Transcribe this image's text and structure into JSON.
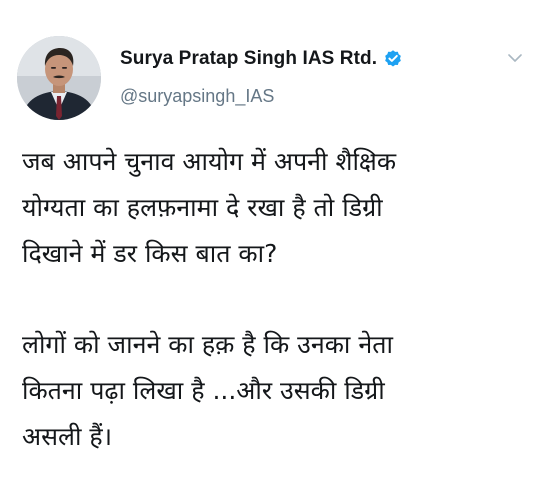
{
  "author": {
    "display_name": "Surya Pratap Singh IAS Rtd.",
    "handle": "@suryapsingh_IAS",
    "verified": true,
    "avatar_icon": "profile-photo",
    "verified_icon": "verified-badge-icon",
    "verified_color": "#1da1f2"
  },
  "menu": {
    "icon": "chevron-down-icon"
  },
  "tweet": {
    "paragraphs": [
      {
        "lines": [
          "जब आपने चुनाव आयोग में अपनी शैक्षिक",
          "योग्यता का हलफ़नामा दे रखा है तो डिग्री",
          "दिखाने में डर किस बात का?"
        ]
      },
      {
        "lines": [
          "लोगों को जानने का हक़ है कि उनका नेता",
          "कितना पढ़ा लिखा है ...और उसकी डिग्री",
          "असली हैं।"
        ]
      }
    ]
  },
  "colors": {
    "name_text": "#14171a",
    "handle_text": "#657786",
    "body_text": "#14171a"
  }
}
